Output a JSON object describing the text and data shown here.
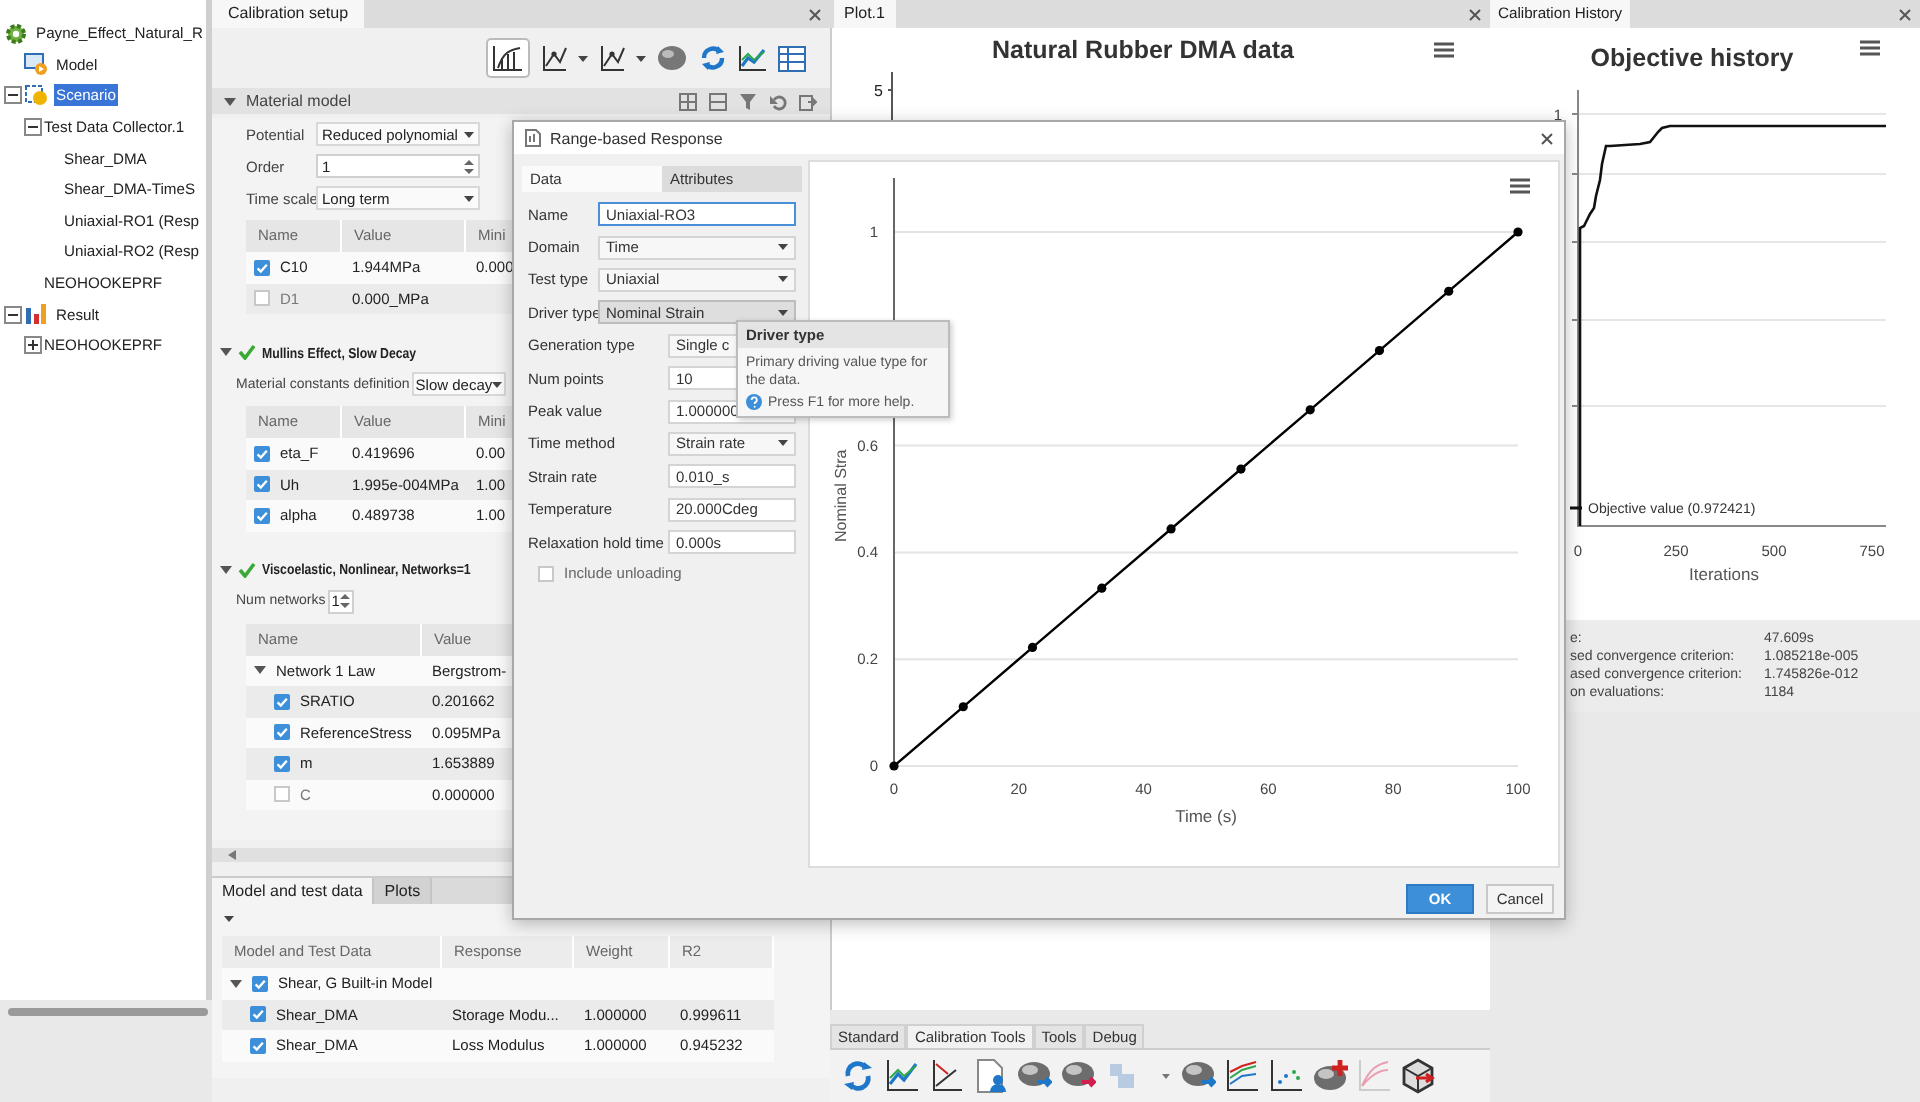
{
  "tree": {
    "items": [
      {
        "label": "Payne_Effect_Natural_R",
        "kind": "project",
        "selected": false,
        "children": [
          {
            "label": "Model",
            "kind": "model",
            "selected": false
          },
          {
            "label": "Scenario",
            "kind": "scenario",
            "selected": true,
            "expanded": true,
            "children": [
              {
                "label": "Test Data Collector.1",
                "selected": false,
                "expanded": true,
                "children": [
                  {
                    "label": "Shear_DMA",
                    "selected": false
                  },
                  {
                    "label": "Shear_DMA-TimeS",
                    "selected": false
                  },
                  {
                    "label": "Uniaxial-RO1 (Resp",
                    "selected": false
                  },
                  {
                    "label": "Uniaxial-RO2 (Resp",
                    "selected": false
                  }
                ]
              },
              {
                "label": "NEOHOOKEPRF",
                "selected": false
              }
            ]
          },
          {
            "label": "Result",
            "kind": "result",
            "selected": false,
            "expanded": true,
            "children": [
              {
                "label": "NEOHOOKEPRF",
                "selected": false,
                "expanded": false
              }
            ]
          }
        ]
      }
    ]
  },
  "calibration_setup": {
    "tab": "Calibration setup",
    "sections": [
      {
        "title": "Material model",
        "kind": "plain",
        "expanded": true,
        "fields": [
          {
            "label": "Potential",
            "kind": "dropdown",
            "value": "Reduced polynomial"
          },
          {
            "label": "Order",
            "kind": "spin",
            "value": "1"
          },
          {
            "label": "Time scale",
            "kind": "dropdown",
            "value": "Long term"
          }
        ],
        "table": {
          "columns": [
            "Name",
            "Value",
            "Mini"
          ],
          "rows": [
            {
              "kind": "param",
              "checked": true,
              "cells": [
                "C10",
                "1.944MPa",
                "0.000"
              ]
            },
            {
              "kind": "param",
              "checked": false,
              "cells": [
                "D1",
                "0.000_MPa"
              ]
            }
          ]
        }
      },
      {
        "title": "Mullins Effect, Slow Decay",
        "kind": "feature",
        "expanded": true,
        "fields": [
          {
            "label": "Material constants definition",
            "kind": "dropdown",
            "value": "Slow decay"
          }
        ],
        "table": {
          "columns": [
            "Name",
            "Value",
            "Mini"
          ],
          "rows": [
            {
              "kind": "param",
              "checked": true,
              "cells": [
                "eta_F",
                "0.419696",
                "0.00"
              ]
            },
            {
              "kind": "param",
              "checked": true,
              "cells": [
                "Uh",
                "1.995e-004MPa",
                "1.00"
              ]
            },
            {
              "kind": "param",
              "checked": true,
              "cells": [
                "alpha",
                "0.489738",
                "1.00"
              ]
            }
          ]
        }
      },
      {
        "title": "Viscoelastic, Nonlinear, Networks=1",
        "kind": "feature",
        "expanded": true,
        "fields": [
          {
            "label": "Num networks",
            "kind": "spin",
            "value": "1"
          }
        ],
        "table": {
          "columns": [
            "Name",
            "Value"
          ],
          "rows": [
            {
              "kind": "group",
              "expanded": true,
              "cells": [
                "Network 1 Law",
                "Bergstrom-"
              ]
            },
            {
              "kind": "param",
              "checked": true,
              "cells": [
                "SRATIO",
                "0.201662"
              ]
            },
            {
              "kind": "param",
              "checked": true,
              "cells": [
                "ReferenceStress",
                "0.095MPa"
              ]
            },
            {
              "kind": "param",
              "checked": true,
              "cells": [
                "m",
                "1.653889"
              ]
            },
            {
              "kind": "param",
              "checked": false,
              "cells": [
                "C",
                "0.000000"
              ]
            }
          ]
        }
      }
    ],
    "data_panel": {
      "tabs": [
        {
          "label": "Model and test data",
          "selected": true
        },
        {
          "label": "Plots",
          "selected": false
        }
      ],
      "table": {
        "columns": [
          "Model and Test Data",
          "Response",
          "Weight",
          "R2"
        ],
        "rows": [
          {
            "kind": "group",
            "expanded": true,
            "checked": true,
            "cells": [
              "Shear, G Built-in Model"
            ]
          },
          {
            "kind": "param",
            "checked": true,
            "cells": [
              "Shear_DMA",
              "Storage Modu...",
              "1.000000",
              "0.999611"
            ]
          },
          {
            "kind": "param",
            "checked": true,
            "cells": [
              "Shear_DMA",
              "Loss Modulus",
              "1.000000",
              "0.945232"
            ]
          }
        ]
      }
    }
  },
  "plot": {
    "tab": "Plot.1",
    "title": "Natural Rubber DMA data",
    "y_tick": "5"
  },
  "toolbar": {
    "tabs": [
      {
        "label": "Standard",
        "selected": false
      },
      {
        "label": "Calibration Tools",
        "selected": true
      },
      {
        "label": "Tools",
        "selected": false
      },
      {
        "label": "Debug",
        "selected": false
      }
    ]
  },
  "history": {
    "tab": "Calibration History",
    "title": "Objective history",
    "y_tick": "1",
    "x_ticks": [
      "0",
      "250",
      "500",
      "750"
    ],
    "xlabel": "Iterations",
    "legend": "Objective value (0.972421)",
    "stats": [
      {
        "label": "e:",
        "value": "47.609s"
      },
      {
        "label": "sed convergence criterion:",
        "value": "1.085218e-005"
      },
      {
        "label": "ased convergence criterion:",
        "value": "1.745826e-012"
      },
      {
        "label": "on evaluations:",
        "value": "1184"
      }
    ]
  },
  "dialog": {
    "title": "Range-based Response",
    "tabs": [
      {
        "label": "Data",
        "selected": true
      },
      {
        "label": "Attributes",
        "selected": false
      }
    ],
    "fields": [
      {
        "label": "Name",
        "kind": "text",
        "value": "Uniaxial-RO3",
        "focused": true,
        "hovered": false
      },
      {
        "label": "Domain",
        "kind": "dropdown",
        "value": "Time",
        "focused": false,
        "hovered": false
      },
      {
        "label": "Test type",
        "kind": "dropdown",
        "value": "Uniaxial",
        "focused": false,
        "hovered": false
      },
      {
        "label": "Driver type",
        "kind": "dropdown",
        "value": "Nominal Strain",
        "focused": false,
        "hovered": true
      },
      {
        "label": "Generation type",
        "kind": "dropdown",
        "value": "Single c",
        "focused": false,
        "hovered": false
      },
      {
        "label": "Num points",
        "kind": "text",
        "value": "10",
        "focused": false,
        "hovered": false
      },
      {
        "label": "Peak value",
        "kind": "text",
        "value": "1.000000",
        "focused": false,
        "hovered": false
      },
      {
        "label": "Time method",
        "kind": "dropdown",
        "value": "Strain rate",
        "focused": false,
        "hovered": false
      },
      {
        "label": "Strain rate",
        "kind": "text",
        "value": "0.010_s",
        "focused": false,
        "hovered": false
      },
      {
        "label": "Temperature",
        "kind": "text",
        "value": "20.000Cdeg",
        "focused": false,
        "hovered": false
      },
      {
        "label": "Relaxation hold time",
        "kind": "text",
        "value": "0.000s",
        "focused": false,
        "hovered": false
      }
    ],
    "checkbox": {
      "label": "Include unloading",
      "checked": false
    },
    "chart_data": {
      "type": "line",
      "xlabel": "Time (s)",
      "ylabel": "Nominal Stra",
      "x": [
        0,
        11.1,
        22.2,
        33.3,
        44.4,
        55.6,
        66.7,
        77.8,
        88.9,
        100
      ],
      "series": [
        {
          "color": "#000000",
          "marker": "circle",
          "values": [
            0,
            0.111,
            0.222,
            0.333,
            0.444,
            0.556,
            0.667,
            0.778,
            0.889,
            1
          ]
        }
      ],
      "xlim": [
        0,
        100
      ],
      "ylim": [
        0,
        1.1
      ],
      "grid": true,
      "xticks": [
        0,
        20,
        40,
        60,
        80,
        100
      ],
      "yticks": [
        0,
        0.2,
        0.4,
        0.6,
        1
      ]
    },
    "tooltip": {
      "title": "Driver type",
      "text": "Primary driving value type for the data.",
      "help": "Press F1 for more help."
    },
    "buttons": [
      {
        "label": "OK",
        "kind": "primary"
      },
      {
        "label": "Cancel",
        "kind": "secondary"
      }
    ]
  }
}
